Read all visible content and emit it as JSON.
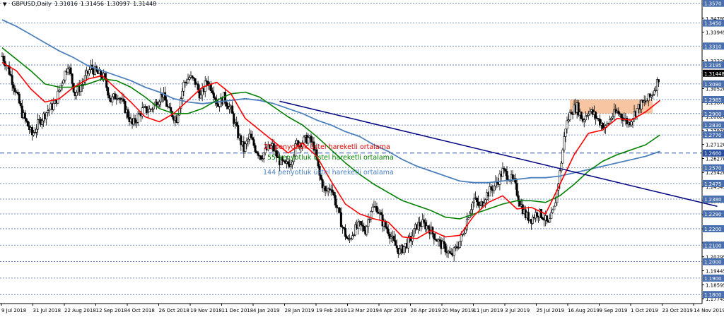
{
  "header": {
    "symbol": "GBPUSD,Daily",
    "open": "1.31016",
    "high": "1.31456",
    "low": "1.30997",
    "close": "1.31448"
  },
  "annotations": [
    {
      "text": "21 penyotluk üstel hareketli ortalama",
      "color": "#e00000"
    },
    {
      "text": "55 penyotluk üstel hareketli ortalama",
      "color": "#008000"
    },
    {
      "text": "144 penyotluk üstel hareketli ortalama",
      "color": "#4a7fbf"
    }
  ],
  "colors": {
    "candle_up": "#000000",
    "candle_down": "#000000",
    "ema21": "#ff0000",
    "ema55": "#008000",
    "ema144": "#4f81bd",
    "trendline": "#000080",
    "level_line": "#4a6fae",
    "highlight_level": "#2a4fa0",
    "zone": "#f4b183",
    "price_badge_bg": "#000000"
  },
  "chart_data": {
    "type": "candlestick",
    "title": "GBPUSD,Daily",
    "ylim": [
      1.1745,
      1.359
    ],
    "grid": false,
    "x_tick_labels": [
      "9 Jul 2018",
      "31 Jul 2018",
      "22 Aug 2018",
      "12 Sep 2018",
      "4 Oct 2018",
      "26 Oct 2018",
      "19 Nov 2018",
      "11 Dec 2018",
      "4 Jan 2019",
      "28 Jan 2019",
      "19 Feb 2019",
      "13 Mar 2019",
      "4 Apr 2019",
      "26 Apr 2019",
      "20 May 2019",
      "11 Jun 2019",
      "3 Jul 2019",
      "25 Jul 2019",
      "16 Aug 2019",
      "9 Sep 2019",
      "1 Oct 2019",
      "23 Oct 2019",
      "14 Nov 2019"
    ],
    "y_tick_labels": [
      "1.34795",
      "1.33945",
      "1.32220",
      "1.30520",
      "1.29670",
      "1.28820",
      "1.27970",
      "1.27120",
      "1.26270",
      "1.25420",
      "1.24545",
      "1.23695",
      "1.22845",
      "1.21995",
      "1.21145",
      "1.20295",
      "1.19445",
      "1.18595",
      "1.17745"
    ],
    "level_lines": [
      1.357,
      1.345,
      1.331,
      1.3195,
      1.308,
      1.2985,
      1.29,
      1.283,
      1.277,
      1.266,
      1.257,
      1.2475,
      1.238,
      1.229,
      1.22,
      1.21,
      1.2,
      1.19,
      1.18
    ],
    "highlight_levels": [
      1.266
    ],
    "current_price": 1.31448,
    "current_price_label": "1.31448",
    "zone": {
      "from": 1.29,
      "to": 1.2985,
      "start": "23 Oct 2019",
      "end": "2 Dec 2019"
    },
    "series_paths": {
      "price": [
        [
          0,
          1.325
        ],
        [
          0.4,
          1.318
        ],
        [
          0.9,
          1.305
        ],
        [
          1.4,
          1.29
        ],
        [
          2.1,
          1.277
        ],
        [
          2.6,
          1.285
        ],
        [
          3.2,
          1.292
        ],
        [
          3.7,
          1.296
        ],
        [
          4.2,
          1.31
        ],
        [
          4.6,
          1.32
        ],
        [
          5.1,
          1.302
        ],
        [
          5.6,
          1.308
        ],
        [
          6.2,
          1.318
        ],
        [
          6.7,
          1.314
        ],
        [
          7.1,
          1.312
        ],
        [
          7.6,
          1.298
        ],
        [
          8.1,
          1.302
        ],
        [
          8.6,
          1.293
        ],
        [
          9.1,
          1.283
        ],
        [
          9.8,
          1.292
        ],
        [
          10.3,
          1.292
        ],
        [
          10.7,
          1.296
        ],
        [
          11.2,
          1.302
        ],
        [
          11.7,
          1.291
        ],
        [
          12.2,
          1.287
        ],
        [
          12.7,
          1.308
        ],
        [
          13.1,
          1.312
        ],
        [
          13.5,
          1.309
        ],
        [
          13.9,
          1.3
        ],
        [
          14.3,
          1.31
        ],
        [
          14.7,
          1.305
        ],
        [
          15.1,
          1.295
        ],
        [
          15.5,
          1.3
        ],
        [
          16.0,
          1.292
        ],
        [
          16.5,
          1.277
        ],
        [
          16.9,
          1.268
        ],
        [
          17.3,
          1.276
        ],
        [
          17.7,
          1.269
        ],
        [
          18.1,
          1.264
        ],
        [
          18.5,
          1.268
        ],
        [
          18.9,
          1.27
        ],
        [
          19.3,
          1.262
        ],
        [
          19.8,
          1.258
        ],
        [
          20.2,
          1.261
        ],
        [
          20.6,
          1.272
        ],
        [
          21.0,
          1.273
        ],
        [
          21.4,
          1.275
        ],
        [
          21.8,
          1.27
        ],
        [
          22.2,
          1.252
        ],
        [
          22.6,
          1.242
        ],
        [
          23.0,
          1.246
        ],
        [
          23.4,
          1.233
        ],
        [
          23.8,
          1.221
        ],
        [
          24.2,
          1.212
        ],
        [
          24.6,
          1.219
        ],
        [
          25.0,
          1.222
        ],
        [
          25.4,
          1.219
        ],
        [
          25.8,
          1.232
        ],
        [
          26.2,
          1.233
        ],
        [
          26.6,
          1.224
        ],
        [
          27.0,
          1.219
        ],
        [
          27.4,
          1.211
        ],
        [
          27.8,
          1.206
        ],
        [
          28.2,
          1.21
        ],
        [
          28.6,
          1.214
        ],
        [
          29.0,
          1.222
        ],
        [
          29.4,
          1.223
        ],
        [
          29.8,
          1.221
        ],
        [
          30.2,
          1.216
        ],
        [
          30.6,
          1.211
        ],
        [
          31.0,
          1.208
        ],
        [
          31.4,
          1.203
        ],
        [
          31.8,
          1.209
        ],
        [
          32.2,
          1.216
        ],
        [
          32.6,
          1.229
        ],
        [
          33.0,
          1.238
        ],
        [
          33.4,
          1.233
        ],
        [
          33.8,
          1.24
        ],
        [
          34.2,
          1.244
        ],
        [
          34.6,
          1.248
        ],
        [
          35.0,
          1.255
        ],
        [
          35.4,
          1.252
        ],
        [
          35.8,
          1.248
        ],
        [
          36.2,
          1.236
        ],
        [
          36.6,
          1.228
        ],
        [
          37.0,
          1.226
        ],
        [
          37.4,
          1.23
        ],
        [
          37.8,
          1.228
        ],
        [
          38.2,
          1.222
        ],
        [
          38.6,
          1.232
        ],
        [
          39.0,
          1.254
        ],
        [
          39.4,
          1.282
        ],
        [
          39.8,
          1.292
        ],
        [
          40.2,
          1.294
        ],
        [
          40.6,
          1.286
        ],
        [
          41.0,
          1.292
        ],
        [
          41.4,
          1.289
        ],
        [
          41.8,
          1.285
        ],
        [
          42.2,
          1.281
        ],
        [
          42.6,
          1.288
        ],
        [
          43.0,
          1.291
        ],
        [
          43.4,
          1.288
        ],
        [
          43.8,
          1.284
        ],
        [
          44.2,
          1.29
        ],
        [
          44.6,
          1.295
        ],
        [
          45.0,
          1.297
        ],
        [
          45.4,
          1.301
        ],
        [
          45.8,
          1.309
        ],
        [
          46.0,
          1.3145
        ]
      ],
      "ema21": [
        [
          0,
          1.321
        ],
        [
          1,
          1.316
        ],
        [
          2,
          1.305
        ],
        [
          3,
          1.297
        ],
        [
          4,
          1.299
        ],
        [
          5,
          1.306
        ],
        [
          6,
          1.311
        ],
        [
          7,
          1.313
        ],
        [
          8,
          1.305
        ],
        [
          9,
          1.297
        ],
        [
          10,
          1.288
        ],
        [
          11,
          1.285
        ],
        [
          12,
          1.29
        ],
        [
          13,
          1.298
        ],
        [
          14,
          1.306
        ],
        [
          15,
          1.309
        ],
        [
          16,
          1.302
        ],
        [
          17,
          1.287
        ],
        [
          18,
          1.28
        ],
        [
          19,
          1.273
        ],
        [
          20,
          1.266
        ],
        [
          21,
          1.272
        ],
        [
          22,
          1.264
        ],
        [
          23,
          1.249
        ],
        [
          24,
          1.235
        ],
        [
          25,
          1.229
        ],
        [
          26,
          1.226
        ],
        [
          27,
          1.224
        ],
        [
          28,
          1.215
        ],
        [
          29,
          1.214
        ],
        [
          30,
          1.219
        ],
        [
          31,
          1.215
        ],
        [
          32,
          1.216
        ],
        [
          33,
          1.228
        ],
        [
          34,
          1.236
        ],
        [
          35,
          1.24
        ],
        [
          36,
          1.232
        ],
        [
          37,
          1.233
        ],
        [
          38,
          1.229
        ],
        [
          39,
          1.247
        ],
        [
          40,
          1.265
        ],
        [
          41,
          1.278
        ],
        [
          42,
          1.28
        ],
        [
          43,
          1.287
        ],
        [
          44,
          1.286
        ],
        [
          45,
          1.291
        ],
        [
          46,
          1.298
        ]
      ],
      "ema55": [
        [
          0,
          1.33
        ],
        [
          1,
          1.323
        ],
        [
          2,
          1.316
        ],
        [
          3,
          1.308
        ],
        [
          4,
          1.306
        ],
        [
          5,
          1.306
        ],
        [
          6,
          1.308
        ],
        [
          7,
          1.311
        ],
        [
          8,
          1.31
        ],
        [
          9,
          1.306
        ],
        [
          10,
          1.3
        ],
        [
          11,
          1.293
        ],
        [
          12,
          1.29
        ],
        [
          13,
          1.29
        ],
        [
          14,
          1.293
        ],
        [
          15,
          1.298
        ],
        [
          16,
          1.302
        ],
        [
          17,
          1.303
        ],
        [
          18,
          1.3
        ],
        [
          19,
          1.294
        ],
        [
          20,
          1.288
        ],
        [
          21,
          1.283
        ],
        [
          22,
          1.276
        ],
        [
          23,
          1.268
        ],
        [
          24,
          1.26
        ],
        [
          25,
          1.253
        ],
        [
          26,
          1.247
        ],
        [
          27,
          1.242
        ],
        [
          28,
          1.237
        ],
        [
          29,
          1.234
        ],
        [
          30,
          1.231
        ],
        [
          31,
          1.227
        ],
        [
          32,
          1.226
        ],
        [
          33,
          1.229
        ],
        [
          34,
          1.232
        ],
        [
          35,
          1.235
        ],
        [
          36,
          1.237
        ],
        [
          37,
          1.237
        ],
        [
          38,
          1.236
        ],
        [
          39,
          1.24
        ],
        [
          40,
          1.247
        ],
        [
          41,
          1.255
        ],
        [
          42,
          1.261
        ],
        [
          43,
          1.265
        ],
        [
          44,
          1.268
        ],
        [
          45,
          1.271
        ],
        [
          46,
          1.277
        ]
      ],
      "ema144": [
        [
          0,
          1.347
        ],
        [
          1,
          1.343
        ],
        [
          2,
          1.338
        ],
        [
          3,
          1.333
        ],
        [
          4,
          1.328
        ],
        [
          5,
          1.324
        ],
        [
          6,
          1.319
        ],
        [
          7,
          1.316
        ],
        [
          8,
          1.313
        ],
        [
          9,
          1.31
        ],
        [
          10,
          1.306
        ],
        [
          11,
          1.303
        ],
        [
          12,
          1.299
        ],
        [
          13,
          1.297
        ],
        [
          14,
          1.296
        ],
        [
          15,
          1.297
        ],
        [
          16,
          1.298
        ],
        [
          17,
          1.299
        ],
        [
          18,
          1.298
        ],
        [
          19,
          1.296
        ],
        [
          20,
          1.293
        ],
        [
          21,
          1.29
        ],
        [
          22,
          1.286
        ],
        [
          23,
          1.283
        ],
        [
          24,
          1.279
        ],
        [
          25,
          1.276
        ],
        [
          26,
          1.271
        ],
        [
          27,
          1.267
        ],
        [
          28,
          1.262
        ],
        [
          29,
          1.258
        ],
        [
          30,
          1.255
        ],
        [
          31,
          1.252
        ],
        [
          32,
          1.249
        ],
        [
          33,
          1.248
        ],
        [
          34,
          1.248
        ],
        [
          35,
          1.249
        ],
        [
          36,
          1.25
        ],
        [
          37,
          1.251
        ],
        [
          38,
          1.251
        ],
        [
          39,
          1.252
        ],
        [
          40,
          1.254
        ],
        [
          41,
          1.256
        ],
        [
          42,
          1.258
        ],
        [
          43,
          1.26
        ],
        [
          44,
          1.262
        ],
        [
          45,
          1.264
        ],
        [
          46,
          1.267
        ]
      ],
      "trendline": [
        [
          19.4,
          1.2975
        ],
        [
          50,
          1.2336
        ]
      ]
    }
  }
}
